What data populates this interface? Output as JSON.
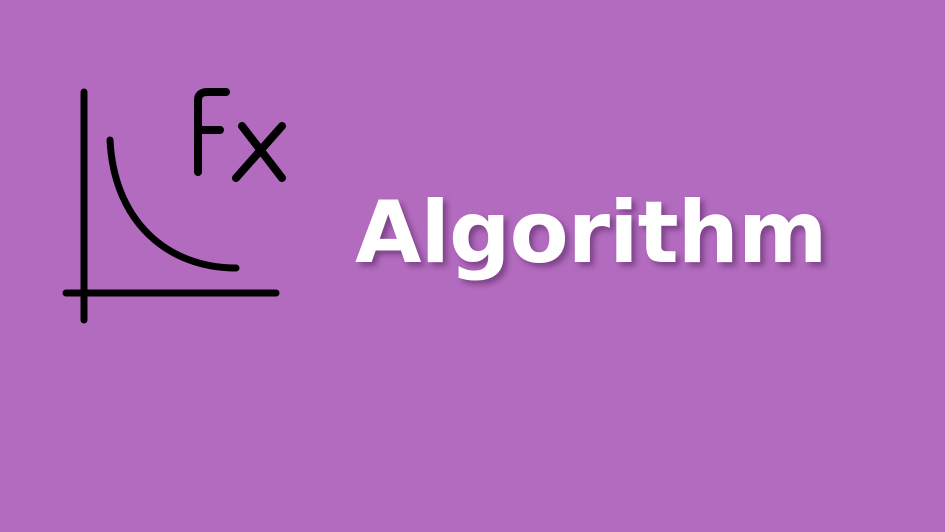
{
  "banner": {
    "title": "Algorithm",
    "background_color": "#b36bbf",
    "title_color": "#ffffff",
    "icon": {
      "name": "function-graph-icon",
      "label": "Fx",
      "stroke_color": "#000000"
    }
  }
}
